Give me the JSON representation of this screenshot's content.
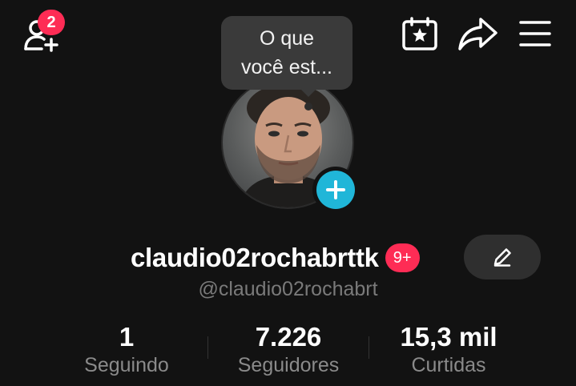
{
  "top_bar": {
    "add_friend_icon": "person-add-icon",
    "notification_count": "2",
    "calendar_icon": "calendar-star-icon",
    "share_icon": "share-arrow-icon",
    "menu_icon": "hamburger-menu-icon"
  },
  "tooltip": {
    "line1": "O que",
    "line2": "você est..."
  },
  "avatar": {
    "add_icon": "plus-icon",
    "add_color": "#20b6d8"
  },
  "profile": {
    "display_name": "claudio02rochabrttk",
    "badge": "9+",
    "handle": "@claudio02rochabrt",
    "edit_icon": "pencil-icon"
  },
  "stats": [
    {
      "value": "1",
      "label": "Seguindo"
    },
    {
      "value": "7.226",
      "label": "Seguidores"
    },
    {
      "value": "15,3 mil",
      "label": "Curtidas"
    }
  ],
  "colors": {
    "background": "#121212",
    "badge": "#fe2c55",
    "accent": "#20b6d8"
  }
}
